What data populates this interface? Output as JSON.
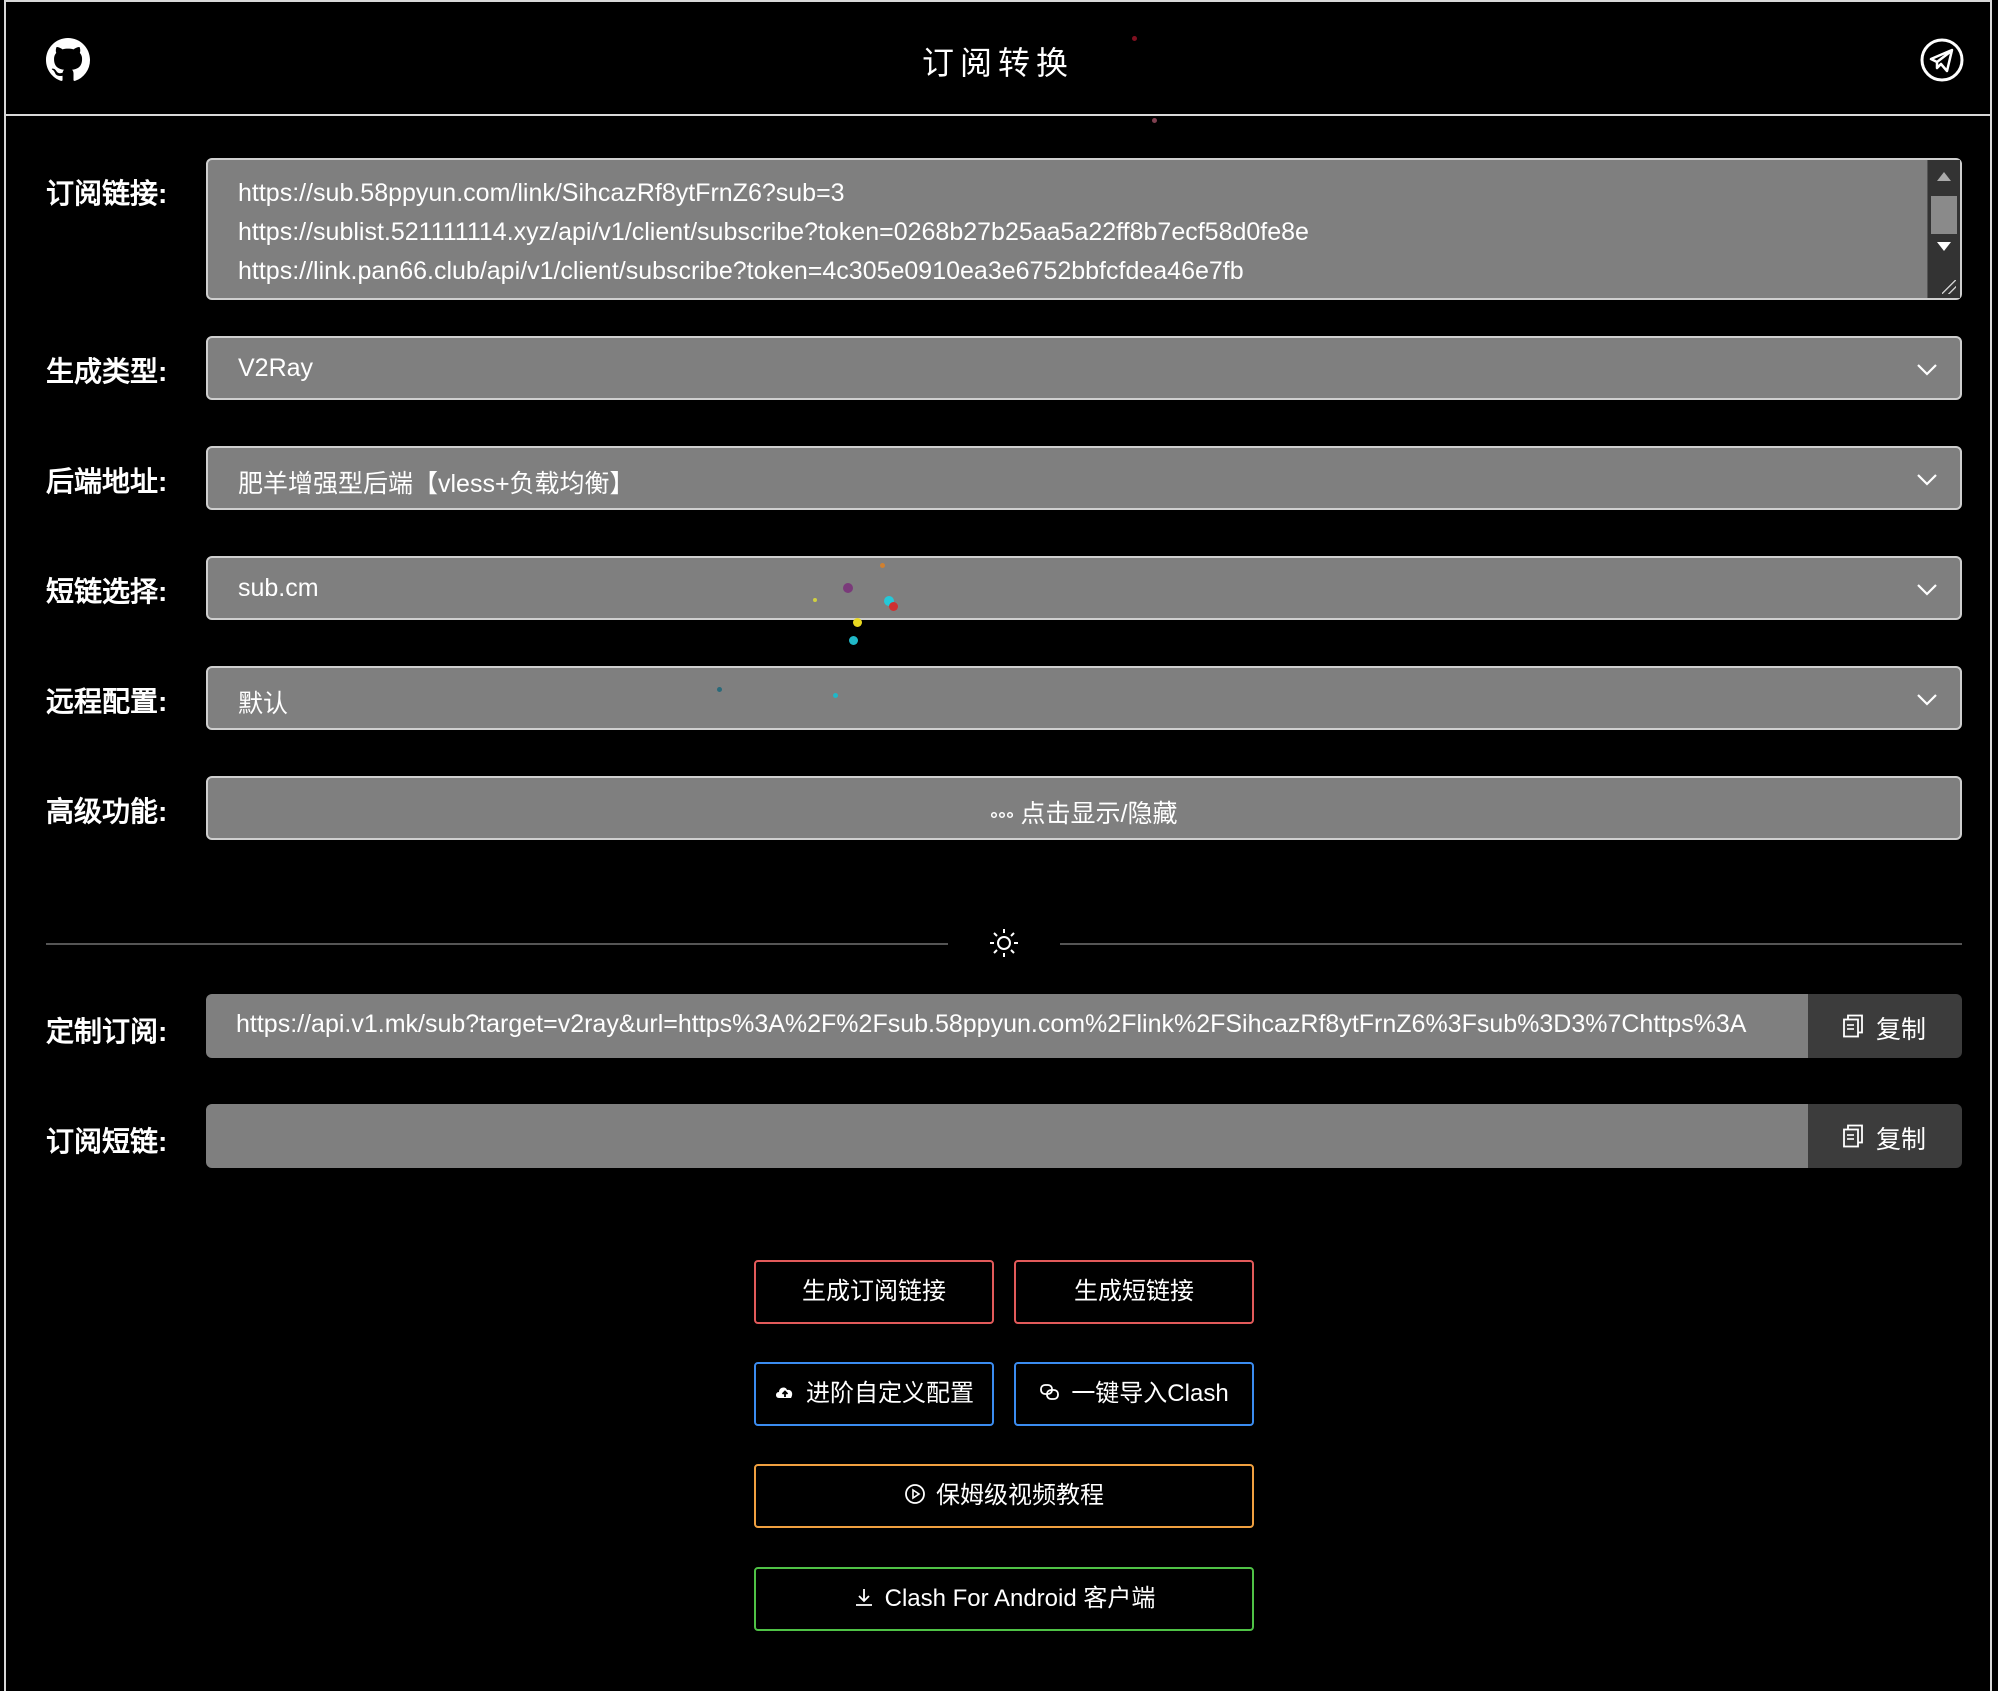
{
  "header": {
    "title": "订阅转换",
    "left_icon": "github-icon",
    "right_icon": "telegram-icon"
  },
  "form": {
    "subscription": {
      "label": "订阅链接:",
      "lines": [
        "https://sub.58ppyun.com/link/SihcazRf8ytFrnZ6?sub=3",
        "https://sublist.521111114.xyz/api/v1/client/subscribe?token=0268b27b25aa5a22ff8b7ecf58d0fe8e",
        "https://link.pan66.club/api/v1/client/subscribe?token=4c305e0910ea3e6752bbfcfdea46e7fb"
      ]
    },
    "target_type": {
      "label": "生成类型:",
      "value": "V2Ray"
    },
    "backend": {
      "label": "后端地址:",
      "value": "肥羊增强型后端【vless+负载均衡】"
    },
    "shortlink": {
      "label": "短链选择:",
      "value": "sub.cm"
    },
    "remote_config": {
      "label": "远程配置:",
      "value": "默认"
    },
    "advanced": {
      "label": "高级功能:",
      "button": "点击显示/隐藏"
    }
  },
  "divider_icon": "sun-icon",
  "outputs": {
    "custom_sub": {
      "label": "定制订阅:",
      "value": "https://api.v1.mk/sub?target=v2ray&url=https%3A%2F%2Fsub.58ppyun.com%2Flink%2FSihcazRf8ytFrnZ6%3Fsub%3D3%7Chttps%3A",
      "copy": "复制"
    },
    "short_sub": {
      "label": "订阅短链:",
      "value": "",
      "copy": "复制"
    }
  },
  "actions": {
    "gen_sub": "生成订阅链接",
    "gen_short": "生成短链接",
    "custom_config": "进阶自定义配置",
    "import_clash": "一键导入Clash",
    "tutorial": "保姆级视频教程",
    "cfa": "Clash For Android 客户端"
  },
  "colors": {
    "field_bg": "#7f7f7f",
    "red": "#e25a5a",
    "blue": "#3b8cf0",
    "orange": "#f0a040",
    "green": "#4fc246"
  }
}
